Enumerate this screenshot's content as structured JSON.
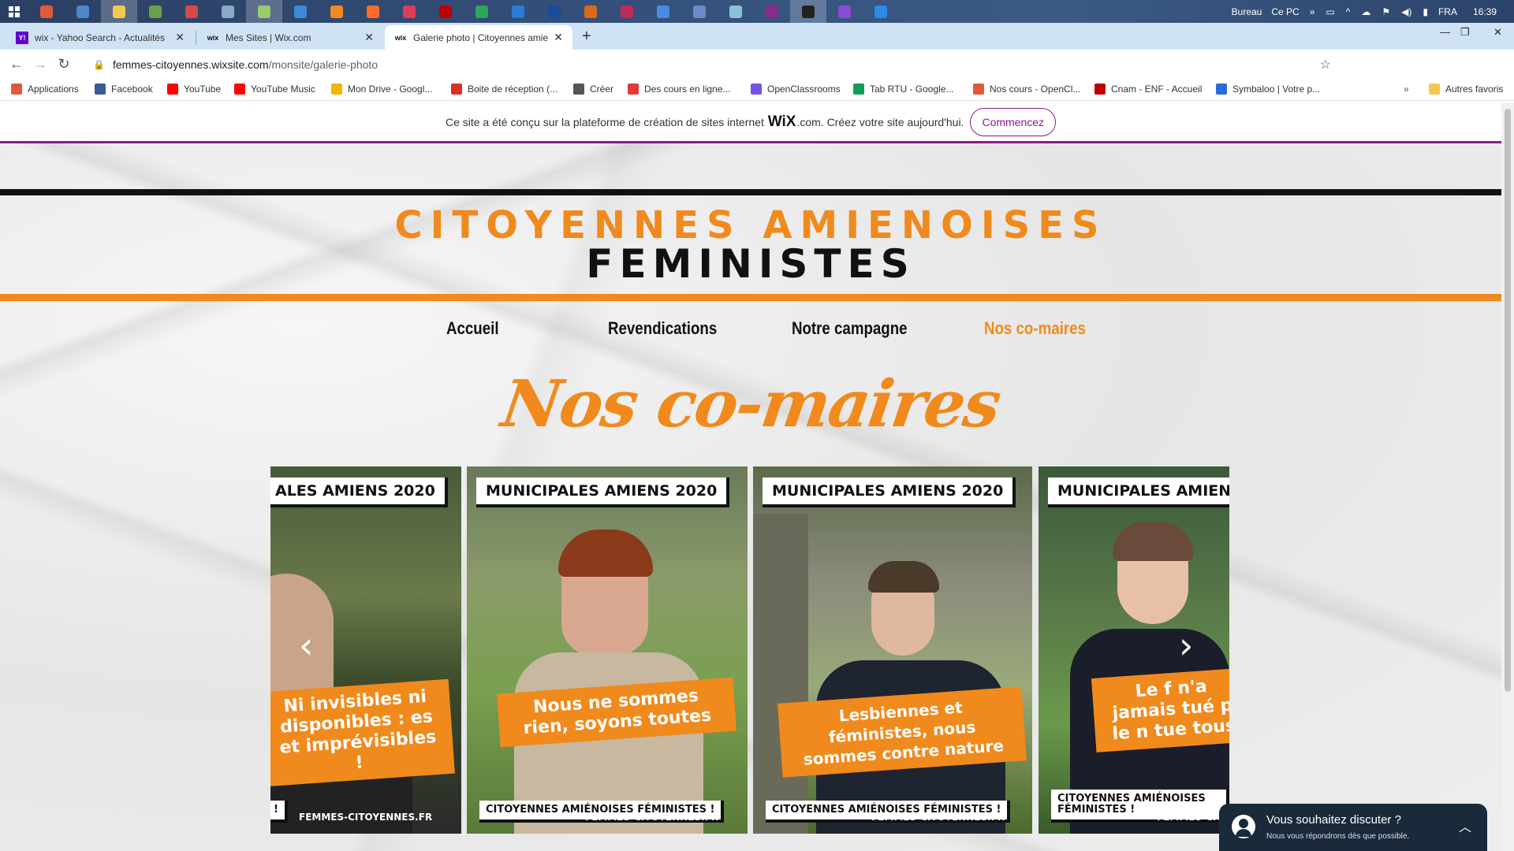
{
  "taskbar": {
    "apps": [
      {
        "name": "app-icon-1",
        "color": "#e05a3a"
      },
      {
        "name": "app-icon-2",
        "color": "#4a88c8"
      },
      {
        "name": "app-icon-3",
        "color": "#f2c94c"
      },
      {
        "name": "app-icon-4",
        "color": "#6ca04a"
      },
      {
        "name": "app-icon-5",
        "color": "#d94848"
      },
      {
        "name": "app-icon-6",
        "color": "#8aa8c8"
      },
      {
        "name": "app-icon-7",
        "color": "#9aca6a"
      },
      {
        "name": "app-icon-8",
        "color": "#3a8ad8"
      },
      {
        "name": "app-icon-9",
        "color": "#f08a1c"
      },
      {
        "name": "app-icon-10",
        "color": "#ff6a2a"
      },
      {
        "name": "app-icon-11",
        "color": "#e03a5a"
      },
      {
        "name": "app-icon-12",
        "color": "#c00000"
      },
      {
        "name": "app-icon-13",
        "color": "#2aa85a"
      },
      {
        "name": "app-icon-14",
        "color": "#2a7ad8"
      },
      {
        "name": "app-icon-15",
        "color": "#1a4a9a"
      },
      {
        "name": "app-icon-16",
        "color": "#d86a1a"
      },
      {
        "name": "app-icon-17",
        "color": "#c02a5a"
      },
      {
        "name": "app-icon-18",
        "color": "#4a8ae8"
      },
      {
        "name": "app-icon-19",
        "color": "#6a8aca"
      },
      {
        "name": "app-icon-20",
        "color": "#8ac0d8"
      },
      {
        "name": "app-icon-21",
        "color": "#8a2a8a"
      },
      {
        "name": "app-icon-22",
        "color": "#222222"
      },
      {
        "name": "app-icon-23",
        "color": "#8a4ad8"
      },
      {
        "name": "app-icon-24",
        "color": "#2a8ae8"
      }
    ],
    "desktop_label": "Bureau",
    "pc_label": "Ce PC",
    "language": "FRA",
    "clock": "16:39"
  },
  "tabs": [
    {
      "title": "wix - Yahoo Search - Actualités",
      "icon": "Y!"
    },
    {
      "title": "Mes Sites | Wix.com",
      "icon": "wix"
    },
    {
      "title": "Galerie photo | Citoyennes amier",
      "icon": "wix"
    }
  ],
  "address": {
    "host": "femmes-citoyennes.wixsite.com",
    "path": "/monsite/galerie-photo"
  },
  "bookmarks": [
    {
      "label": "Applications",
      "color": "#e05a3a"
    },
    {
      "label": "Facebook",
      "color": "#3b5998"
    },
    {
      "label": "YouTube",
      "color": "#ff0000"
    },
    {
      "label": "YouTube Music",
      "color": "#ff0000"
    },
    {
      "label": "Mon Drive - Googl...",
      "color": "#f4b400"
    },
    {
      "label": "Boite de réception (...",
      "color": "#d93025"
    },
    {
      "label": "Créer",
      "color": "#555555"
    },
    {
      "label": "Des cours en ligne...",
      "color": "#e03a3a"
    },
    {
      "label": "OpenClassrooms",
      "color": "#7451eb"
    },
    {
      "label": "Tab RTU - Google...",
      "color": "#0f9d58"
    },
    {
      "label": "Nos cours - OpenCl...",
      "color": "#e05a3a"
    },
    {
      "label": "Cnam - ENF - Accueil",
      "color": "#c00000"
    },
    {
      "label": "Symbaloo | Votre p...",
      "color": "#2a6ad8"
    }
  ],
  "bookmarks_more": "Autres favoris",
  "wix_banner": {
    "text_before": "Ce site a été conçu sur la plateforme de création de sites internet",
    "logo": "WiX",
    "text_after": ".com. Créez votre site aujourd'hui.",
    "button": "Commencez"
  },
  "site": {
    "title_line1": "CITOYENNES AMIENOISES",
    "title_line2": "FEMINISTES",
    "menu": [
      "Accueil",
      "Revendications",
      "Notre campagne",
      "Nos co-maires"
    ],
    "current_menu": "Nos co-maires",
    "page_heading": "Nos co-maires"
  },
  "gallery": {
    "cards": [
      {
        "header": "ALES AMIENS 2020",
        "slogan": "Ni invisibles ni disponibles : es et imprévisibles !",
        "brand": "!",
        "url": "FEMMES-CITOYENNES.FR"
      },
      {
        "header": "MUNICIPALES AMIENS 2020",
        "slogan": "Nous ne sommes rien, soyons toutes",
        "brand": "CITOYENNES AMIÉNOISES FÉMINISTES !",
        "url": "FEMMES-CITOYENNES.FR"
      },
      {
        "header": "MUNICIPALES AMIENS 2020",
        "slogan": "Lesbiennes et féministes, nous sommes contre nature",
        "brand": "CITOYENNES AMIÉNOISES FÉMINISTES !",
        "url": "FEMMES-CITOYENNES.FR"
      },
      {
        "header": "MUNICIPALES AMIENS",
        "slogan": "Le f n'a jamais tué p le n tue tous",
        "brand": "CITOYENNES AMIÉNOISES FÉMINISTES !",
        "url": "FEMMES-CIT"
      }
    ],
    "prev_arrow": "‹",
    "next_arrow": "›"
  },
  "chat": {
    "title": "Vous souhaitez discuter ?",
    "subtitle": "Nous vous répondrons dès que possible."
  }
}
